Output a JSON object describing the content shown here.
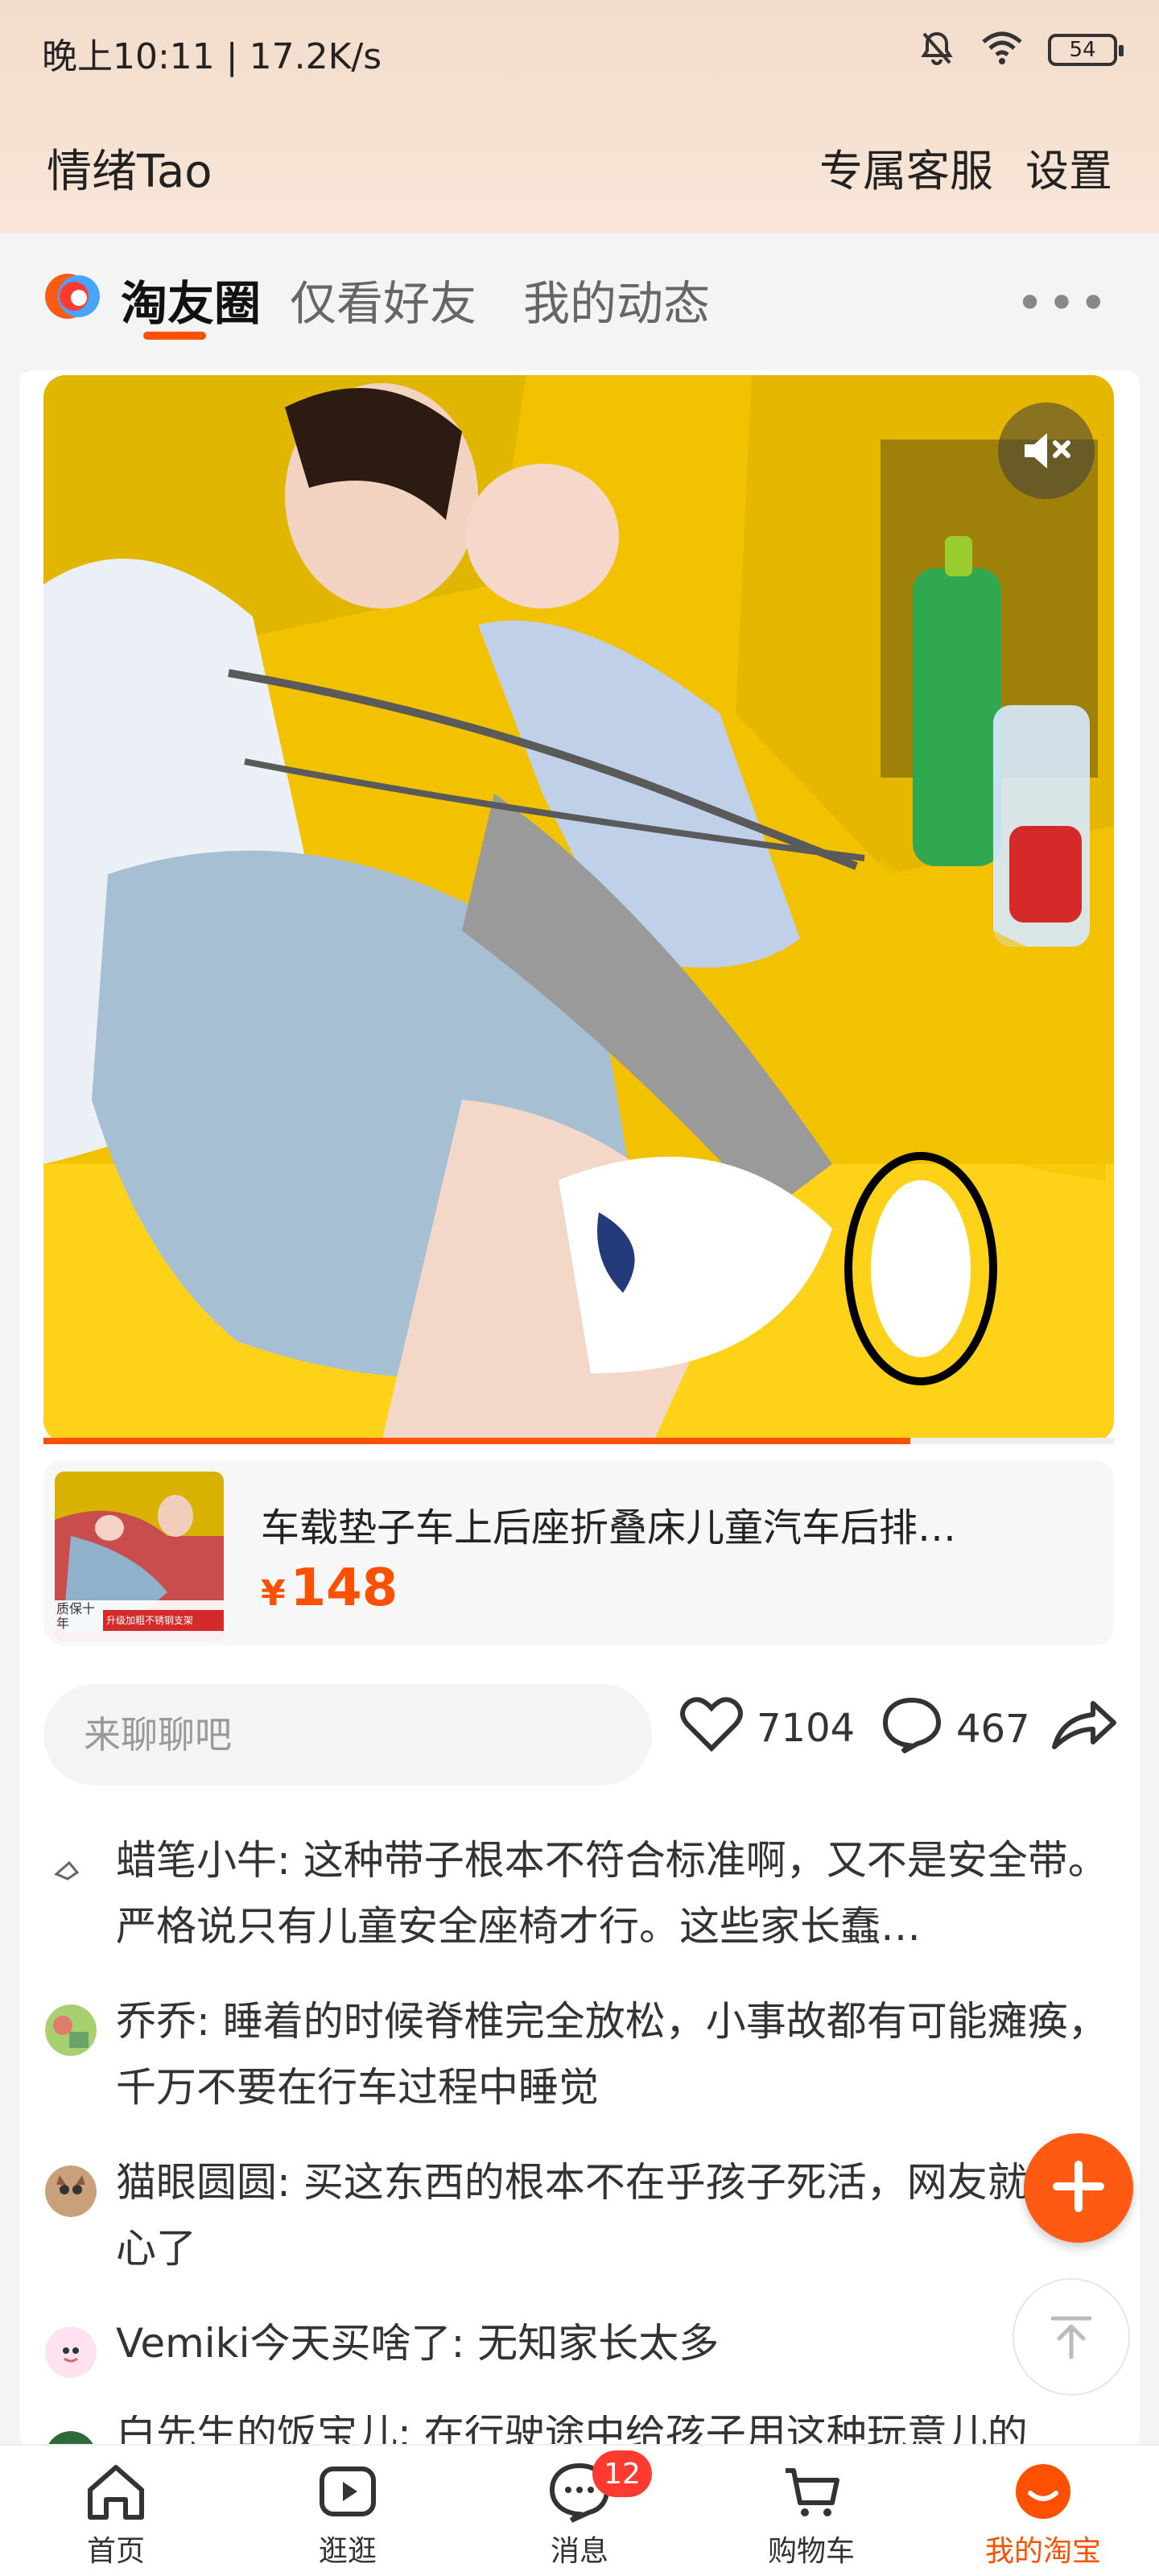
{
  "status_bar": {
    "time_net": "晚上10:11 | 17.2K/s",
    "battery": "54"
  },
  "header": {
    "title": "情绪Tao",
    "actions": [
      "专属客服",
      "设置"
    ]
  },
  "tabs": {
    "items": [
      "淘友圈",
      "仅看好友",
      "我的动态"
    ],
    "active_index": 0,
    "more_icon": "more-dots-icon"
  },
  "post": {
    "media": {
      "type": "video",
      "muted": true,
      "progress": 0.81
    },
    "product": {
      "title": "车载垫子车上后座折叠床儿童汽车后排…",
      "price_symbol": "¥",
      "price": "148",
      "thumb_caption_1": "质保十年",
      "thumb_caption_2": "升级加粗不锈钢支架"
    },
    "actions": {
      "comment_placeholder": "来聊聊吧",
      "likes": "7104",
      "comments": "467"
    },
    "comments": [
      {
        "user": "蜡笔小牛",
        "text": "这种带子根本不符合标准啊，又不是安全带。严格说只有儿童安全座椅才行。这些家长蠢…"
      },
      {
        "user": "乔乔",
        "text": "睡着的时候脊椎完全放松，小事故都有可能瘫痪，千万不要在行车过程中睡觉"
      },
      {
        "user": "猫眼圆圆",
        "text": "买这东西的根本不在乎孩子死活，网友就别操心了"
      },
      {
        "user": "Vemiki今天买啥了",
        "text": "无知家长太多"
      },
      {
        "user": "白先生的饭宝儿",
        "text": "在行驶途中给孩子用这种玩意儿的"
      }
    ]
  },
  "bottom_nav": {
    "items": [
      {
        "label": "首页",
        "icon": "home-icon"
      },
      {
        "label": "逛逛",
        "icon": "video-play-icon"
      },
      {
        "label": "消息",
        "icon": "chat-bubble-icon",
        "badge": "12"
      },
      {
        "label": "购物车",
        "icon": "cart-icon"
      },
      {
        "label": "我的淘宝",
        "icon": "taobao-smile-icon"
      }
    ],
    "active_index": 4
  },
  "colors": {
    "accent": "#ff5000",
    "badge": "#ff3b30",
    "header_bg": "#f3dccb"
  }
}
